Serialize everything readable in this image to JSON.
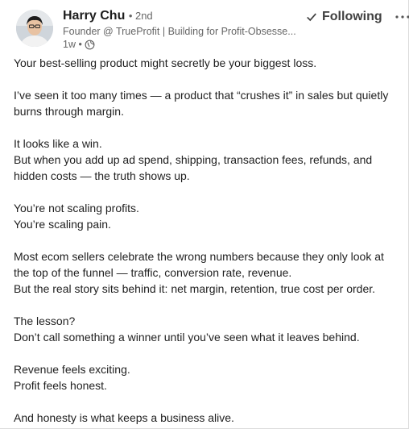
{
  "post": {
    "author": {
      "name": "Harry Chu",
      "degree": "• 2nd",
      "headline": "Founder @ TrueProfit | Building for Profit-Obsesse...",
      "time": "1w •"
    },
    "follow_label": "Following",
    "paragraphs": [
      [
        "Your best-selling product might secretly be your biggest loss."
      ],
      [
        "I’ve seen it too many times — a product that “crushes it” in sales but quietly",
        "burns through margin."
      ],
      [
        "It looks like a win.",
        "But when you add up ad spend, shipping, transaction fees, refunds, and",
        "hidden costs — the truth shows up."
      ],
      [
        "You’re not scaling profits.",
        "You’re scaling pain."
      ],
      [
        "Most ecom sellers celebrate the wrong numbers because they only look at",
        "the top of the funnel — traffic, conversion rate, revenue.",
        "But the real story sits behind it: net margin, retention, true cost per order."
      ],
      [
        "The lesson?",
        "Don’t call something a winner until you’ve seen what it leaves behind."
      ],
      [
        "Revenue feels exciting.",
        "Profit feels honest."
      ],
      [
        "And honesty is what keeps a business alive."
      ]
    ]
  },
  "icons": {
    "follow": "checkmark-icon",
    "more": "more-horizontal-icon",
    "visibility": "globe-icon"
  }
}
